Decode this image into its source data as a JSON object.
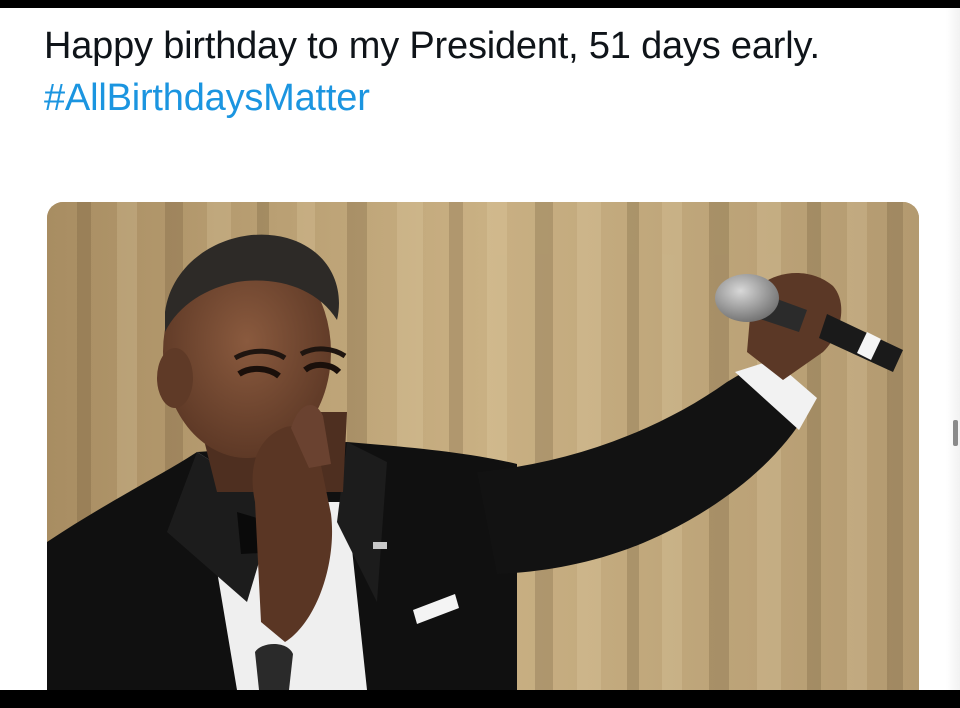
{
  "tweet": {
    "text_before": "Happy birthday to my President, 51 days early. ",
    "hashtag": "#AllBirthdaysMatter"
  },
  "colors": {
    "text": "#0f1419",
    "hashtag": "#1b95e0",
    "frame": "#000000"
  },
  "media": {
    "alt": "photo"
  }
}
